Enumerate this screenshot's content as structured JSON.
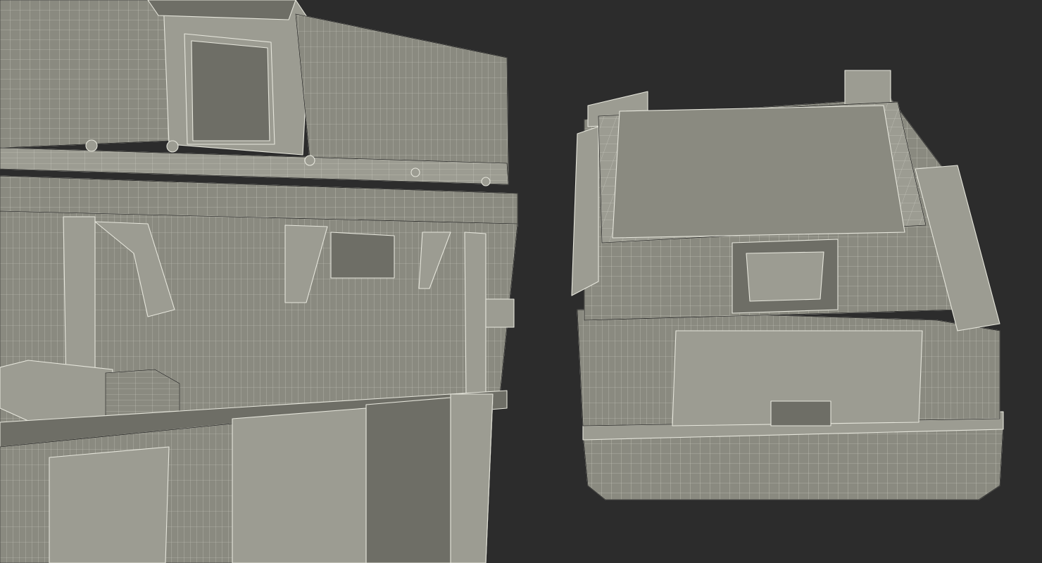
{
  "scene": {
    "background_color": "#2c2c2c",
    "surface_color": "#8a8a80",
    "surface_light": "#9c9c92",
    "surface_dark": "#6e6e66",
    "wire_color": "#e6e6dc",
    "outline_color": "#1d1d1b",
    "views": [
      {
        "name": "closeup-view",
        "description_kind": "wireframe-closeup"
      },
      {
        "name": "full-view",
        "description_kind": "wireframe-perspective"
      }
    ]
  }
}
